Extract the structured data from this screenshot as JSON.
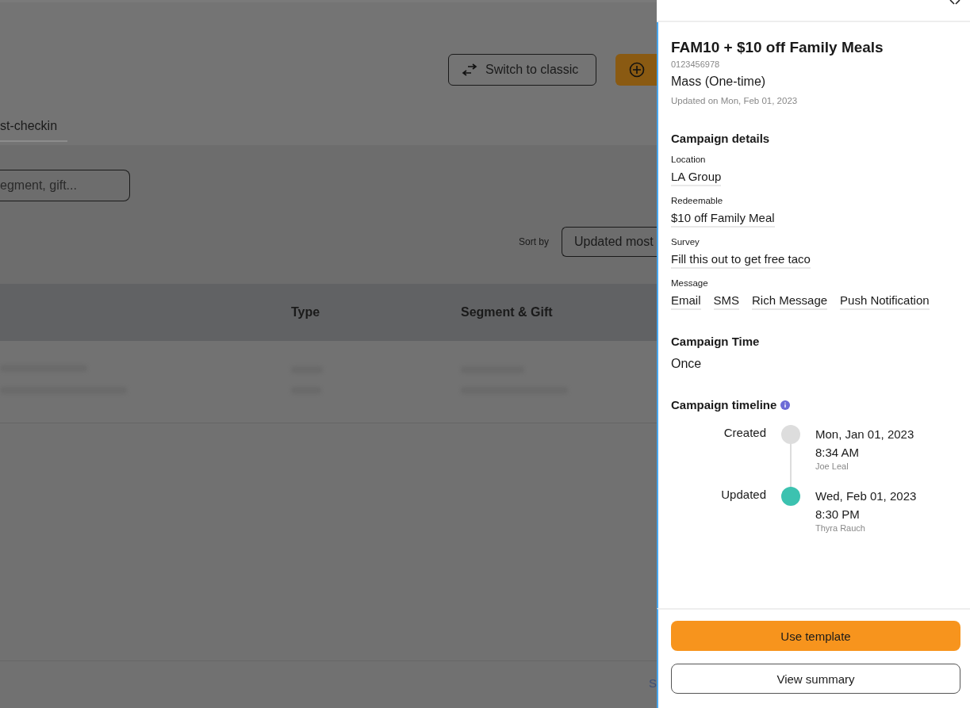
{
  "page": {
    "switch_button": {
      "label": "Switch to classic"
    },
    "tab": {
      "label": "st-checkin",
      "selected": true
    },
    "search": {
      "placeholder": "egment, gift..."
    },
    "sort": {
      "label": "Sort by",
      "value": "Updated most"
    },
    "table": {
      "columns": [
        "",
        "Type",
        "Segment & Gift"
      ]
    },
    "footer_link": "S"
  },
  "drawer": {
    "title": "FAM10 + $10 off Family Meals",
    "code": "0123456978",
    "type": "Mass (One-time)",
    "updated": "Updated on Mon, Feb 01, 2023",
    "details": {
      "heading": "Campaign details",
      "fields": [
        {
          "label": "Location",
          "values": [
            "LA Group"
          ]
        },
        {
          "label": "Redeemable",
          "values": [
            "$10 off Family Meal"
          ]
        },
        {
          "label": "Survey",
          "values": [
            "Fill this out to get free taco"
          ]
        },
        {
          "label": "Message",
          "values": [
            "Email",
            "SMS",
            "Rich Message",
            "Push Notification"
          ]
        }
      ]
    },
    "time": {
      "heading": "Campaign Time",
      "value": "Once"
    },
    "timeline": {
      "heading": "Campaign timeline",
      "events": [
        {
          "label": "Created",
          "date": "Mon, Jan 01, 2023",
          "time": "8:34 AM",
          "user": "Joe Leal",
          "current": false
        },
        {
          "label": "Updated",
          "date": "Wed, Feb 01, 2023",
          "time": "8:30 PM",
          "user": "Thyra Rauch",
          "current": true
        }
      ]
    },
    "buttons": [
      {
        "label": "Use template",
        "kind": "primary"
      },
      {
        "label": "View summary",
        "kind": "secondary"
      }
    ]
  }
}
